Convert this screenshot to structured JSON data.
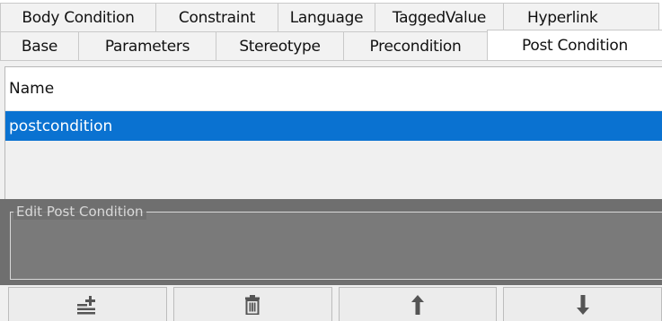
{
  "tabs_top": [
    {
      "label": "Body Condition",
      "width": 174
    },
    {
      "label": "Constraint",
      "width": 137
    },
    {
      "label": "Language",
      "width": 109
    },
    {
      "label": "TaggedValue",
      "width": 144
    },
    {
      "label": "Hyperlink",
      "width": 115
    }
  ],
  "tabs_bottom": [
    {
      "label": "Base",
      "width": 88
    },
    {
      "label": "Parameters",
      "width": 154
    },
    {
      "label": "Stereotype",
      "width": 143
    },
    {
      "label": "Precondition",
      "width": 161
    },
    {
      "label": "Post Condition",
      "width": 191
    }
  ],
  "list": {
    "column_header": "Name",
    "rows": [
      "postcondition"
    ]
  },
  "edit_section": {
    "legend": "Edit Post Condition"
  },
  "toolbar": {
    "add_icon": "add-list-icon",
    "delete_icon": "trash-icon",
    "up_icon": "arrow-up-icon",
    "down_icon": "arrow-down-icon"
  },
  "colors": {
    "selection": "#0a72d1",
    "edit_background": "#6f6f6f"
  }
}
